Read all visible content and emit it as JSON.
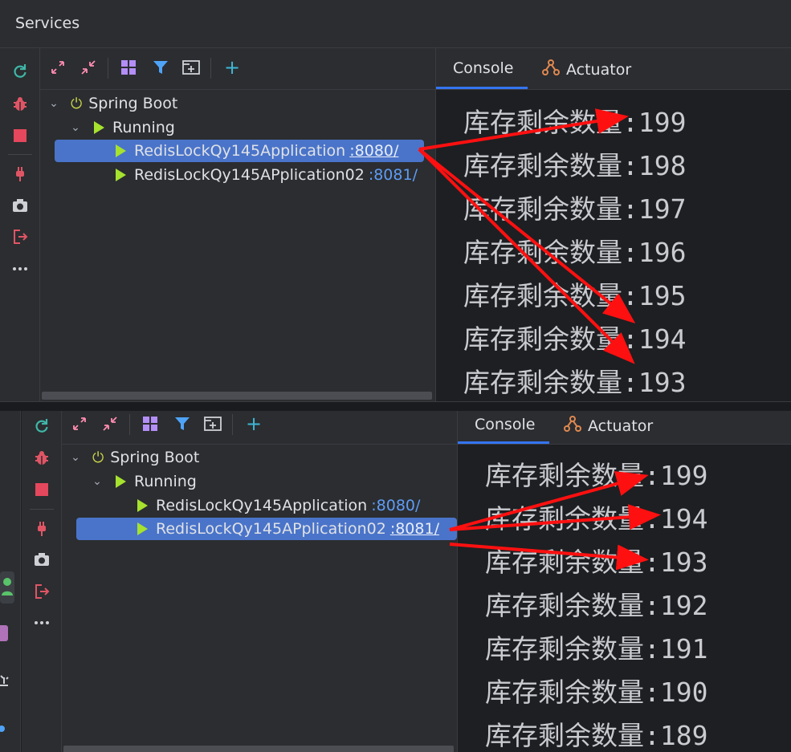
{
  "window": {
    "title": "Services"
  },
  "colors": {
    "accent": "#3574f0",
    "selection": "#4a74c9",
    "running": "#a6e22e",
    "arrow": "#ff1010",
    "port": "#5e9cf5"
  },
  "top": {
    "toolbar": {
      "expand_all": "expand-all-icon",
      "collapse_all": "collapse-all-icon",
      "group": "group-by-icon",
      "filter": "filter-icon",
      "new_tab": "open-in-new-tab-icon",
      "add": "+"
    },
    "tree": {
      "root": "Spring Boot",
      "group": "Running",
      "apps": [
        {
          "name": "RedisLockQy145Application",
          "port": ":8080/"
        },
        {
          "name": "RedisLockQy145APplication02",
          "port": ":8081/"
        }
      ]
    },
    "tabs": {
      "console": "Console",
      "actuator": "Actuator"
    },
    "console": [
      "库存剩余数量:199",
      "库存剩余数量:198",
      "库存剩余数量:197",
      "库存剩余数量:196",
      "库存剩余数量:195",
      "库存剩余数量:194",
      "库存剩余数量:193"
    ]
  },
  "bottom": {
    "tree": {
      "root": "Spring Boot",
      "group": "Running",
      "apps": [
        {
          "name": "RedisLockQy145Application",
          "port": ":8080/"
        },
        {
          "name": "RedisLockQy145APplication02",
          "port": ":8081/"
        }
      ]
    },
    "tabs": {
      "console": "Console",
      "actuator": "Actuator"
    },
    "console": [
      "库存剩余数量:199",
      "库存剩余数量:194",
      "库存剩余数量:193",
      "库存剩余数量:192",
      "库存剩余数量:191",
      "库存剩余数量:190",
      "库存剩余数量:189"
    ]
  }
}
